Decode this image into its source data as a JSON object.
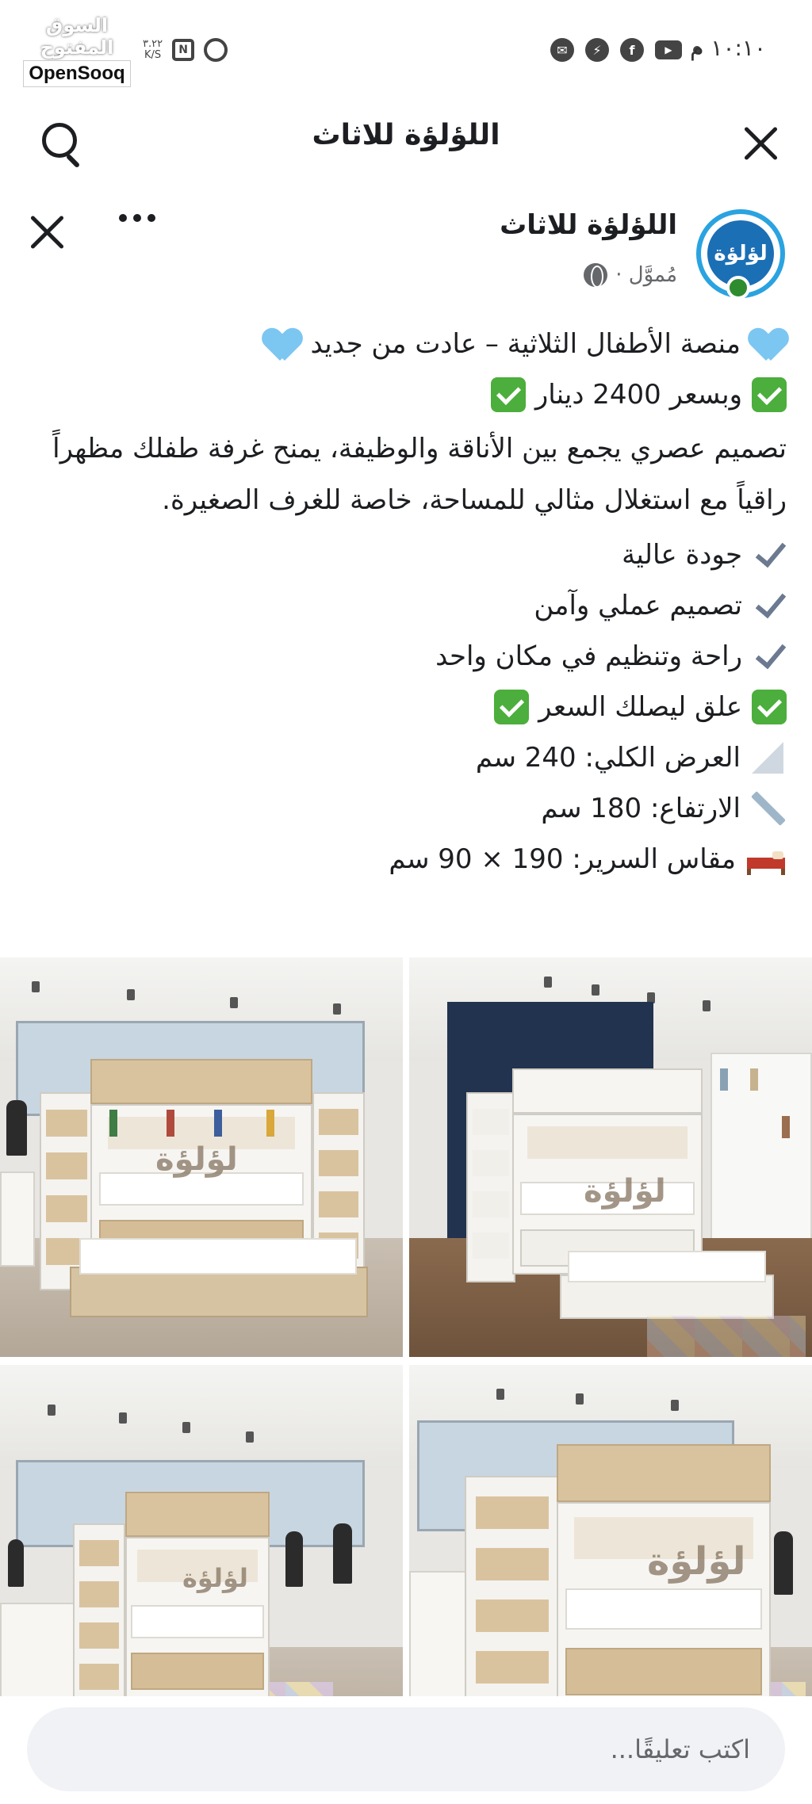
{
  "status_bar": {
    "time": "١٠:١٠ م",
    "network_speed": "٣.٢٢",
    "network_unit": "K/S",
    "nfc_label": "N"
  },
  "watermark": {
    "arabic": "السوق المفتوح",
    "latin": "OpenSooq"
  },
  "top_bar": {
    "title": "اللؤلؤة للاثاث"
  },
  "page_header": {
    "name": "اللؤلؤة للاثاث",
    "sponsored": "مُموَّل ·",
    "avatar_text": "لؤلؤة"
  },
  "post": {
    "line1": "منصة الأطفال الثلاثية – عادت من جديد",
    "line2": "وبسعر 2400 دينار",
    "paragraph": "تصميم عصري يجمع بين الأناقة والوظيفة، يمنح غرفة طفلك مظهراً راقياً مع استغلال مثالي للمساحة، خاصة للغرف الصغيرة.",
    "features": [
      "جودة عالية",
      "تصميم عملي وآمن",
      "راحة وتنظيم في مكان واحد"
    ],
    "cta": "علق ليصلك السعر",
    "width": "العرض الكلي: 240 سم",
    "height": "الارتفاع: 180 سم",
    "bed_size": "مقاس السرير: 190 × 90 سم"
  },
  "photos": {
    "watermark_text": "لؤلؤة"
  },
  "comment": {
    "placeholder": "اكتب تعليقًا..."
  }
}
